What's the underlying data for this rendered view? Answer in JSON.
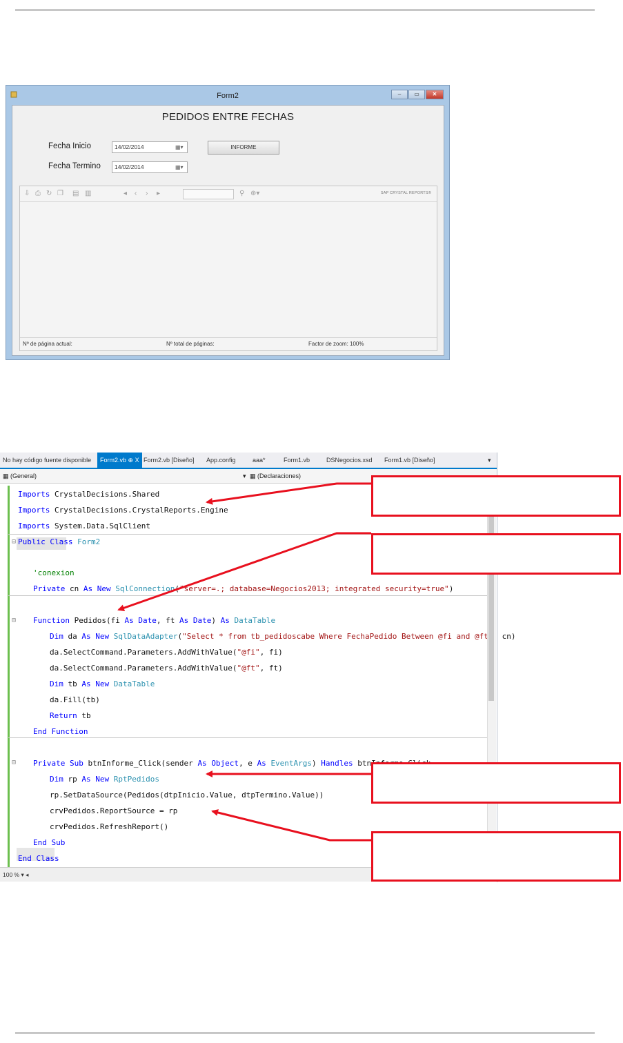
{
  "form_window": {
    "title": "Form2",
    "heading": "PEDIDOS ENTRE FECHAS",
    "fecha_inicio_label": "Fecha Inicio",
    "fecha_inicio_value": "14/02/2014",
    "fecha_termino_label": "Fecha Termino",
    "fecha_termino_value": "14/02/2014",
    "informe_button": "INFORME",
    "viewer": {
      "brand": "SAP CRYSTAL REPORTS®",
      "status_page": "Nº de página actual:",
      "status_total": "Nº total de páginas:",
      "status_zoom": "Factor de zoom: 100%"
    }
  },
  "editor": {
    "tabs": [
      {
        "label": "No hay código fuente disponible",
        "active": false
      },
      {
        "label": "Form2.vb",
        "active": true,
        "suffix": "⊕ X"
      },
      {
        "label": "Form2.vb [Diseño]",
        "active": false
      },
      {
        "label": "App.config",
        "active": false
      },
      {
        "label": "aaa*",
        "active": false
      },
      {
        "label": "Form1.vb",
        "active": false
      },
      {
        "label": "DSNegocios.xsd",
        "active": false
      },
      {
        "label": "Form1.vb [Diseño]",
        "active": false
      }
    ],
    "general_combo": "(General)",
    "declarations_combo": "(Declaraciones)",
    "zoom": "100 %",
    "accent_color": "#007acc"
  },
  "code": [
    "Imports CrystalDecisions.Shared",
    "Imports CrystalDecisions.CrystalReports.Engine",
    "Imports System.Data.SqlClient",
    "Public Class Form2",
    "'conexion",
    "Private cn As New SqlConnection(\"server=.; database=Negocios2013; integrated security=true\")",
    "Function Pedidos(fi As Date, ft As Date) As DataTable",
    "Dim da As New SqlDataAdapter(\"Select * from tb_pedidoscabe Where FechaPedido Between @fi and @ft\", cn)",
    "da.SelectCommand.Parameters.AddWithValue(\"@fi\", fi)",
    "da.SelectCommand.Parameters.AddWithValue(\"@ft\", ft)",
    "Dim tb As New DataTable",
    "da.Fill(tb)",
    "Return tb",
    "End Function",
    "Private Sub btnInforme_Click(sender As Object, e As EventArgs) Handles btnInforme.Click",
    "Dim rp As New RptPedidos",
    "rp.SetDataSource(Pedidos(dtpInicio.Value, dtpTermino.Value))",
    "crvPedidos.ReportSource = rp",
    "crvPedidos.RefreshReport()",
    "End Sub",
    "End Class"
  ],
  "annotation_color": "#e8101e"
}
